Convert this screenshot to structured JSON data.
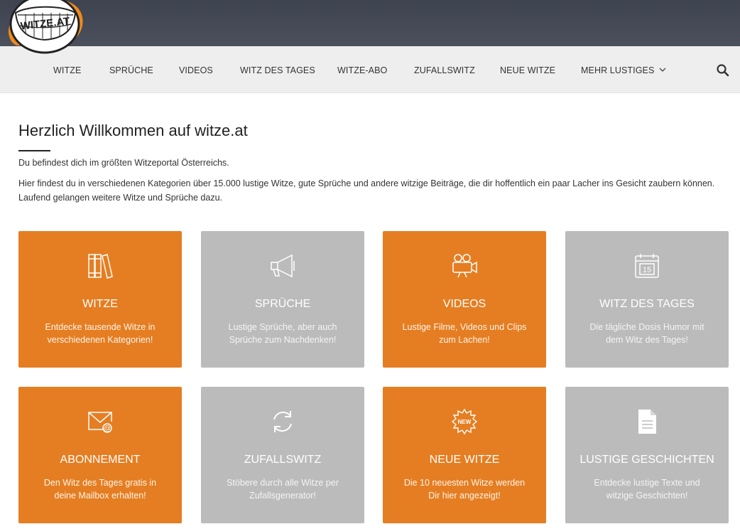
{
  "logo": {
    "text": "WITZE.AT"
  },
  "nav": {
    "items": [
      {
        "label": "Witze"
      },
      {
        "label": "Sprüche"
      },
      {
        "label": "Videos"
      },
      {
        "label": "Witz des Tages"
      },
      {
        "label": "Witze-Abo"
      },
      {
        "label": "Zufallswitz"
      },
      {
        "label": "Neue Witze"
      },
      {
        "label": "Mehr Lustiges"
      }
    ],
    "search_icon": "search-icon"
  },
  "main": {
    "title": "Herzlich Willkommen auf witze.at",
    "intro_1": "Du befindest dich im größten Witzeportal Österreichs.",
    "intro_2": "Hier findest du in verschiedenen Kategorien über 15.000 lustige Witze, gute Sprüche und andere witzige Beiträge, die dir hoffentlich ein paar Lacher ins Gesicht zaubern können. Laufend gelangen weitere Witze und Sprüche dazu."
  },
  "colors": {
    "orange": "#e57e22",
    "gray": "#bbbbbb",
    "topbar": "#454a56",
    "navbar": "#eeeeee"
  },
  "cards": [
    {
      "title": "WITZE",
      "desc": "Entdecke tausende Witze in verschiedenen Kategorien!",
      "icon": "books-icon"
    },
    {
      "title": "SPRÜCHE",
      "desc": "Lustige Sprüche, aber auch Sprüche zum Nachdenken!",
      "icon": "megaphone-icon"
    },
    {
      "title": "VIDEOS",
      "desc": "Lustige Filme, Videos und Clips zum Lachen!",
      "icon": "video-camera-icon"
    },
    {
      "title": "WITZ DES TAGES",
      "desc": "Die tägliche Dosis Humor mit dem Witz des Tages!",
      "icon": "calendar-icon",
      "icon_text": "15"
    },
    {
      "title": "ABONNEMENT",
      "desc": "Den Witz des Tages gratis in deine Mailbox erhalten!",
      "icon": "mail-icon"
    },
    {
      "title": "ZUFALLSWITZ",
      "desc": "Stöbere durch alle Witze per Zufallsgenerator!",
      "icon": "refresh-icon"
    },
    {
      "title": "NEUE WITZE",
      "desc": "Die 10 neuesten Witze werden Dir hier angezeigt!",
      "icon": "new-badge-icon",
      "icon_text": "NEW"
    },
    {
      "title": "LUSTIGE GESCHICHTEN",
      "desc": "Entdecke lustige Texte und witzige Geschichten!",
      "icon": "document-icon"
    }
  ]
}
